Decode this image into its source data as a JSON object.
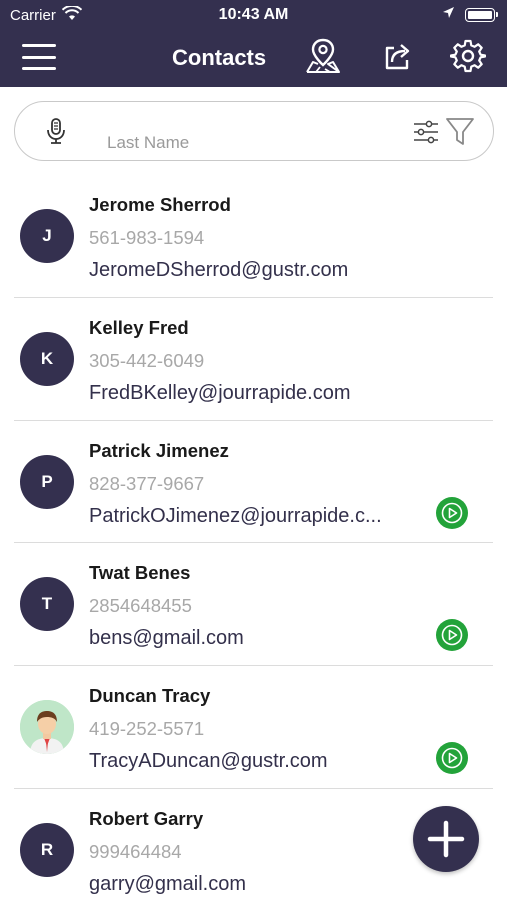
{
  "status_bar": {
    "carrier": "Carrier",
    "time": "10:43 AM"
  },
  "nav": {
    "title": "Contacts"
  },
  "search": {
    "placeholder": "Last Name",
    "value": ""
  },
  "contacts": [
    {
      "initial": "J",
      "name": "Jerome Sherrod",
      "phone": "561-983-1594",
      "email": "JeromeDSherrod@gustr.com",
      "has_play": false,
      "avatar": "initial"
    },
    {
      "initial": "K",
      "name": "Kelley Fred",
      "phone": "305-442-6049",
      "email": "FredBKelley@jourrapide.com",
      "has_play": false,
      "avatar": "initial"
    },
    {
      "initial": "P",
      "name": "Patrick Jimenez",
      "phone": "828-377-9667",
      "email": "PatrickOJimenez@jourrapide.c...",
      "has_play": true,
      "avatar": "initial"
    },
    {
      "initial": "T",
      "name": "Twat Benes",
      "phone": "2854648455",
      "email": "bens@gmail.com",
      "has_play": true,
      "avatar": "initial"
    },
    {
      "initial": "",
      "name": "Duncan Tracy",
      "phone": "419-252-5571",
      "email": "TracyADuncan@gustr.com",
      "has_play": true,
      "avatar": "photo"
    },
    {
      "initial": "R",
      "name": "Robert Garry",
      "phone": "999464484",
      "email": "garry@gmail.com",
      "has_play": false,
      "avatar": "initial"
    }
  ],
  "colors": {
    "header": "#34304f",
    "play": "#23a33a",
    "phone": "#a8a8a8"
  },
  "icons": [
    "menu-icon",
    "map-pin-icon",
    "share-icon",
    "gear-icon",
    "microphone-icon",
    "sliders-icon",
    "filter-icon",
    "play-icon",
    "plus-icon"
  ]
}
